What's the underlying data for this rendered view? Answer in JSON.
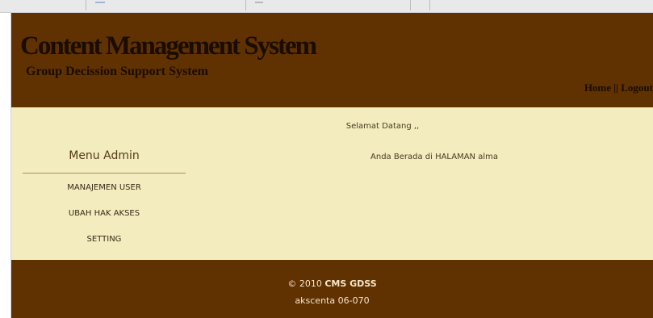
{
  "header": {
    "title": "Content Management System",
    "subtitle": "Group Decission Support System",
    "nav": {
      "home": "Home",
      "separator": " || ",
      "logout": "Logout"
    }
  },
  "sidebar": {
    "title": "Menu Admin",
    "items": [
      {
        "label": "MANAJEMEN USER"
      },
      {
        "label": "UBAH HAK AKSES"
      },
      {
        "label": "SETTING"
      }
    ]
  },
  "main": {
    "welcome": "Selamat Datang ,,",
    "location_text": "Anda Berada di HALAMAN alma"
  },
  "footer": {
    "copyright_prefix": "© 2010 ",
    "copyright_name": "CMS GDSS",
    "credit": "akscenta 06-070"
  },
  "colors": {
    "header_bg": "#603101",
    "content_bg": "#f2ecbf",
    "footer_bg": "#603101",
    "divider": "#b68b55"
  }
}
